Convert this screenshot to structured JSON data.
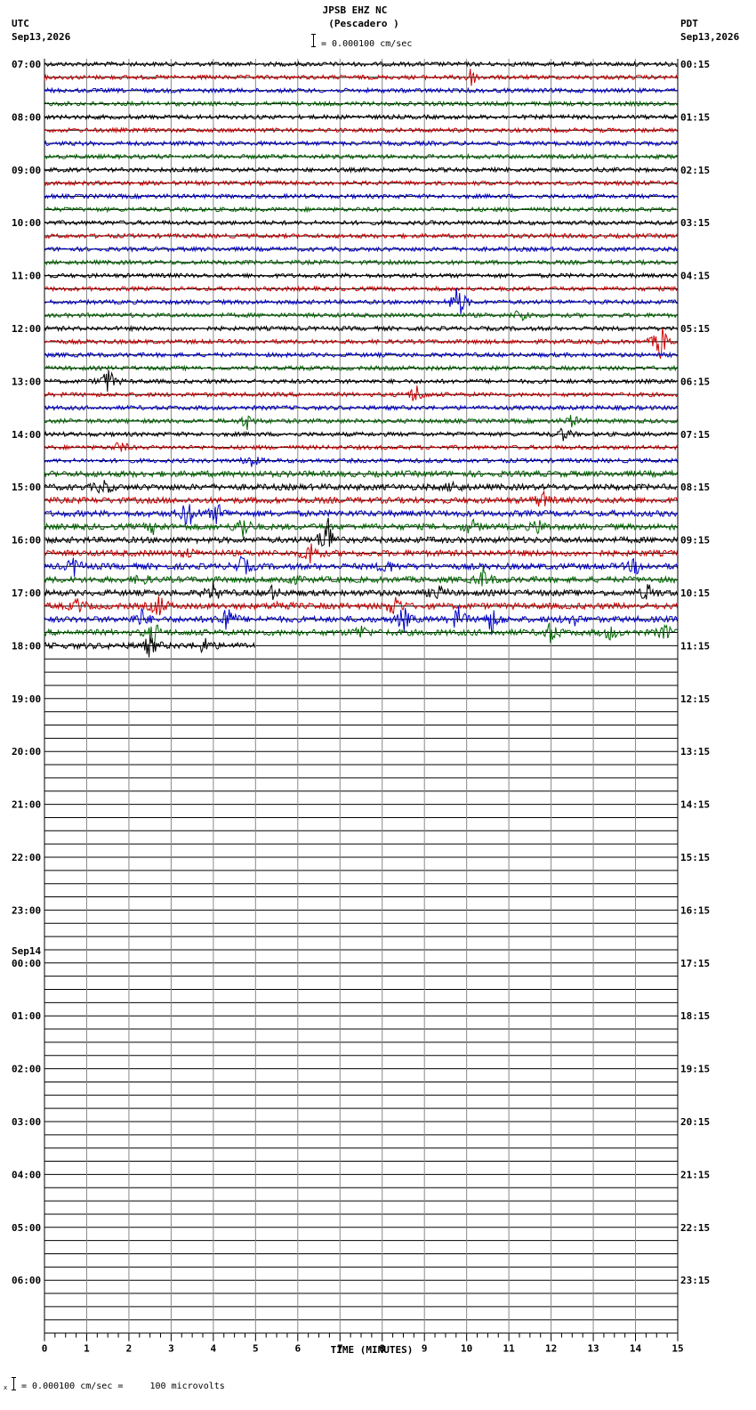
{
  "header": {
    "station": "JPSB EHZ NC",
    "location": "(Pescadero )",
    "scale_text": "= 0.000100 cm/sec",
    "left_tz": "UTC",
    "left_date": "Sep13,2026",
    "right_tz": "PDT",
    "right_date": "Sep13,2026"
  },
  "footer": {
    "scale_text": "= 0.000100 cm/sec =     100 microvolts"
  },
  "colors": {
    "trace_cycle": [
      "#000000",
      "#cc0000",
      "#0000cc",
      "#006600"
    ],
    "grid": "#000000",
    "minute_line": "#888888"
  },
  "chart_data": {
    "type": "seismogram",
    "xlabel": "TIME (MINUTES)",
    "xlim": [
      0,
      15
    ],
    "x_ticks": [
      "0",
      "1",
      "2",
      "3",
      "4",
      "5",
      "6",
      "7",
      "8",
      "9",
      "10",
      "11",
      "12",
      "13",
      "14",
      "15"
    ],
    "rows_per_hour": 4,
    "total_rows": 96,
    "recorded_rows": 45,
    "last_row_minutes": 5,
    "left_hour_labels": [
      "07:00",
      "08:00",
      "09:00",
      "10:00",
      "11:00",
      "12:00",
      "13:00",
      "14:00",
      "15:00",
      "16:00",
      "17:00",
      "18:00",
      "19:00",
      "20:00",
      "21:00",
      "22:00",
      "23:00",
      "00:00",
      "01:00",
      "02:00",
      "03:00",
      "04:00",
      "05:00",
      "06:00"
    ],
    "day_change_label": "Sep14",
    "day_change_index": 17,
    "right_hour_labels": [
      "00:15",
      "01:15",
      "02:15",
      "03:15",
      "04:15",
      "05:15",
      "06:15",
      "07:15",
      "08:15",
      "09:15",
      "10:15",
      "11:15",
      "12:15",
      "13:15",
      "14:15",
      "15:15",
      "16:15",
      "17:15",
      "18:15",
      "19:15",
      "20:15",
      "21:15",
      "22:15",
      "23:15"
    ],
    "events": [
      {
        "row": 1,
        "minute": 10.1,
        "amp": 10
      },
      {
        "row": 18,
        "minute": 9.8,
        "amp": 22
      },
      {
        "row": 19,
        "minute": 11.3,
        "amp": 9
      },
      {
        "row": 21,
        "minute": 14.6,
        "amp": 22
      },
      {
        "row": 24,
        "minute": 1.5,
        "amp": 16
      },
      {
        "row": 25,
        "minute": 8.8,
        "amp": 12
      },
      {
        "row": 27,
        "minute": 4.8,
        "amp": 9
      },
      {
        "row": 27,
        "minute": 12.5,
        "amp": 7
      },
      {
        "row": 28,
        "minute": 12.3,
        "amp": 8
      },
      {
        "row": 29,
        "minute": 1.8,
        "amp": 7
      },
      {
        "row": 30,
        "minute": 4.9,
        "amp": 8
      },
      {
        "row": 32,
        "minute": 1.4,
        "amp": 9
      },
      {
        "row": 32,
        "minute": 9.7,
        "amp": 6
      },
      {
        "row": 33,
        "minute": 11.8,
        "amp": 10
      },
      {
        "row": 34,
        "minute": 3.4,
        "amp": 18
      },
      {
        "row": 34,
        "minute": 4.1,
        "amp": 12
      },
      {
        "row": 35,
        "minute": 4.7,
        "amp": 14
      },
      {
        "row": 35,
        "minute": 2.6,
        "amp": 7
      },
      {
        "row": 35,
        "minute": 10.1,
        "amp": 9
      },
      {
        "row": 35,
        "minute": 11.7,
        "amp": 8
      },
      {
        "row": 36,
        "minute": 6.7,
        "amp": 30
      },
      {
        "row": 37,
        "minute": 6.3,
        "amp": 14
      },
      {
        "row": 37,
        "minute": 3.4,
        "amp": 5
      },
      {
        "row": 38,
        "minute": 0.7,
        "amp": 10
      },
      {
        "row": 38,
        "minute": 4.7,
        "amp": 12
      },
      {
        "row": 38,
        "minute": 8.1,
        "amp": 8
      },
      {
        "row": 38,
        "minute": 14.0,
        "amp": 9
      },
      {
        "row": 39,
        "minute": 5.8,
        "amp": 8
      },
      {
        "row": 39,
        "minute": 10.4,
        "amp": 12
      },
      {
        "row": 39,
        "minute": 2.3,
        "amp": 6
      },
      {
        "row": 40,
        "minute": 4.0,
        "amp": 10
      },
      {
        "row": 40,
        "minute": 9.3,
        "amp": 9
      },
      {
        "row": 40,
        "minute": 14.3,
        "amp": 10
      },
      {
        "row": 40,
        "minute": 5.4,
        "amp": 7
      },
      {
        "row": 41,
        "minute": 2.7,
        "amp": 14
      },
      {
        "row": 41,
        "minute": 8.3,
        "amp": 14
      },
      {
        "row": 41,
        "minute": 0.8,
        "amp": 8
      },
      {
        "row": 41,
        "minute": 5.6,
        "amp": 6
      },
      {
        "row": 42,
        "minute": 4.3,
        "amp": 18
      },
      {
        "row": 42,
        "minute": 8.5,
        "amp": 14
      },
      {
        "row": 42,
        "minute": 9.8,
        "amp": 14
      },
      {
        "row": 42,
        "minute": 10.6,
        "amp": 16
      },
      {
        "row": 42,
        "minute": 2.3,
        "amp": 10
      },
      {
        "row": 42,
        "minute": 12.5,
        "amp": 8
      },
      {
        "row": 43,
        "minute": 2.6,
        "amp": 12
      },
      {
        "row": 43,
        "minute": 7.5,
        "amp": 8
      },
      {
        "row": 43,
        "minute": 12.0,
        "amp": 12
      },
      {
        "row": 43,
        "minute": 13.4,
        "amp": 7
      },
      {
        "row": 43,
        "minute": 14.7,
        "amp": 9
      },
      {
        "row": 44,
        "minute": 2.5,
        "amp": 12
      },
      {
        "row": 44,
        "minute": 3.8,
        "amp": 9
      }
    ]
  }
}
